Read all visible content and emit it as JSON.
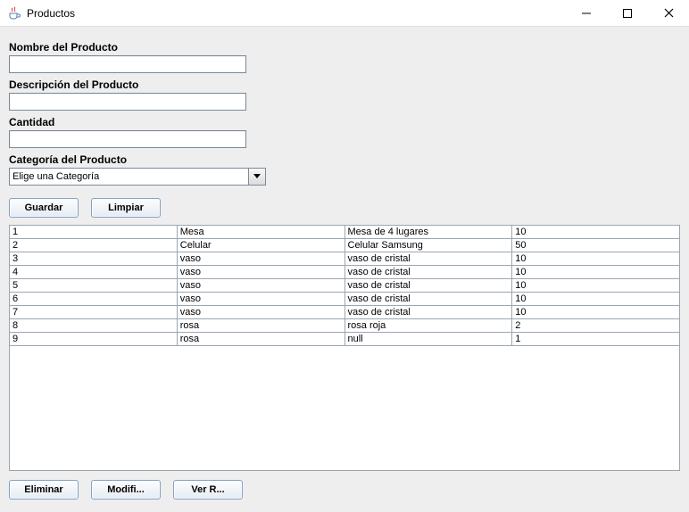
{
  "window": {
    "title": "Productos"
  },
  "form": {
    "nombre_label": "Nombre del Producto",
    "nombre_value": "",
    "descripcion_label": "Descripción del Producto",
    "descripcion_value": "",
    "cantidad_label": "Cantidad",
    "cantidad_value": "",
    "categoria_label": "Categoría del Producto",
    "categoria_selected": "Elige una Categoría"
  },
  "buttons": {
    "guardar": "Guardar",
    "limpiar": "Limpiar",
    "eliminar": "Eliminar",
    "modificar": "Modifi...",
    "ver": "Ver R..."
  },
  "table": {
    "rows": [
      {
        "id": "1",
        "nombre": "Mesa",
        "descripcion": "Mesa de 4 lugares",
        "cantidad": "10"
      },
      {
        "id": "2",
        "nombre": "Celular",
        "descripcion": "Celular Samsung",
        "cantidad": "50"
      },
      {
        "id": "3",
        "nombre": "vaso",
        "descripcion": "vaso de cristal",
        "cantidad": "10"
      },
      {
        "id": "4",
        "nombre": "vaso",
        "descripcion": "vaso de cristal",
        "cantidad": "10"
      },
      {
        "id": "5",
        "nombre": "vaso",
        "descripcion": "vaso de cristal",
        "cantidad": "10"
      },
      {
        "id": "6",
        "nombre": "vaso",
        "descripcion": "vaso de cristal",
        "cantidad": "10"
      },
      {
        "id": "7",
        "nombre": "vaso",
        "descripcion": "vaso de cristal",
        "cantidad": "10"
      },
      {
        "id": "8",
        "nombre": "rosa",
        "descripcion": "rosa roja",
        "cantidad": "2"
      },
      {
        "id": "9",
        "nombre": "rosa",
        "descripcion": "null",
        "cantidad": "1"
      }
    ]
  }
}
